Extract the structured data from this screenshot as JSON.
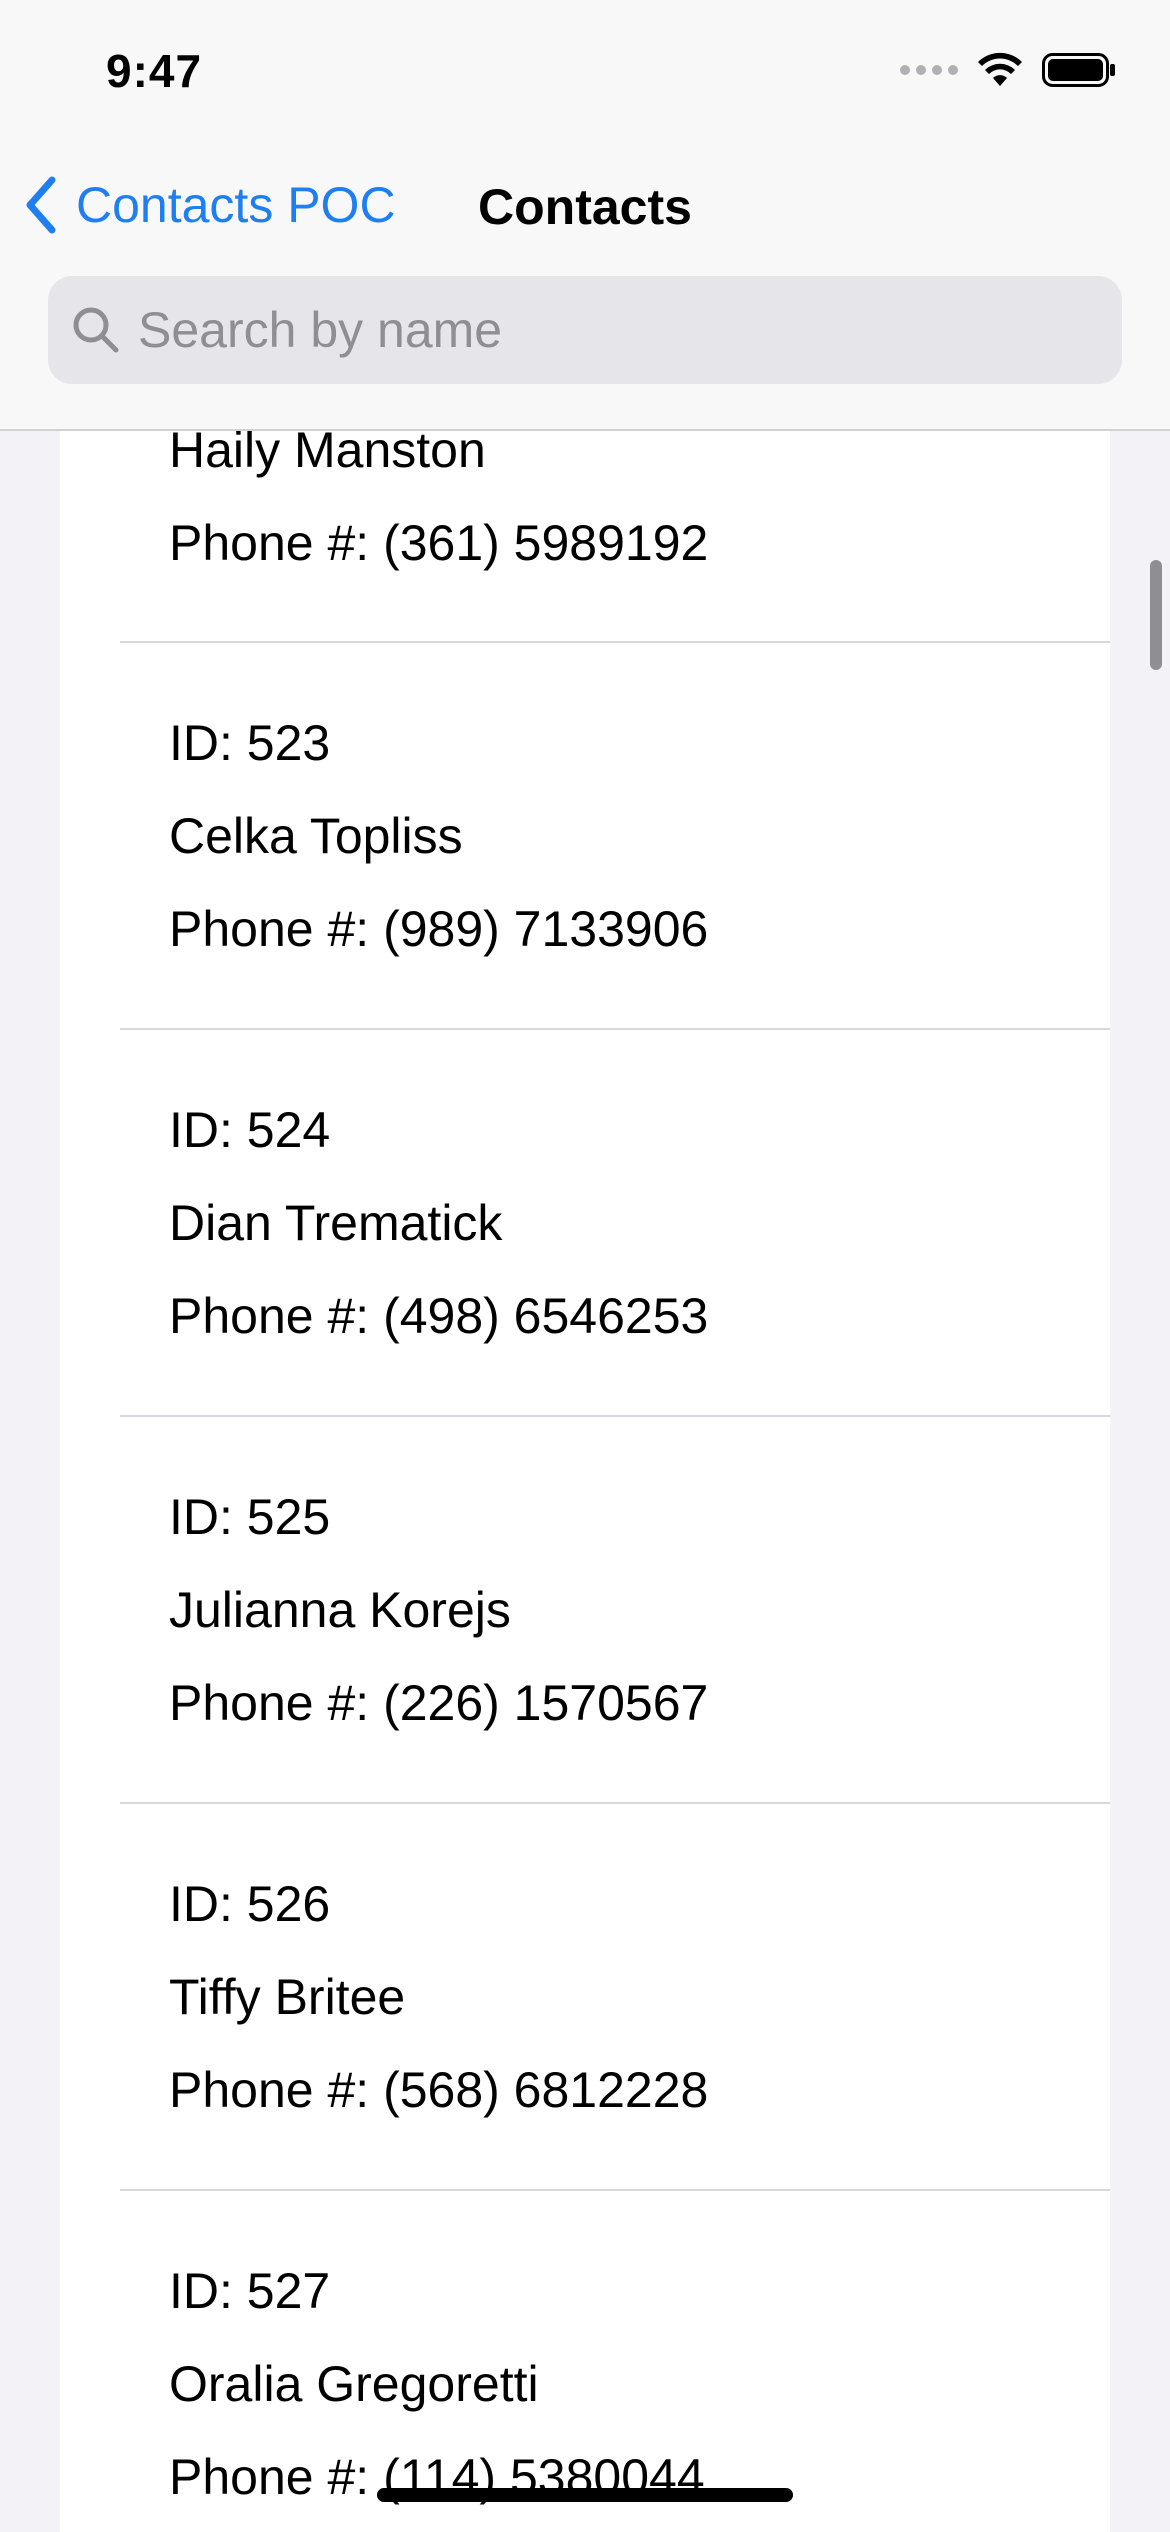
{
  "status_bar": {
    "time": "9:47"
  },
  "nav": {
    "back_label": "Contacts POC",
    "title": "Contacts"
  },
  "search": {
    "placeholder": "Search by name",
    "value": ""
  },
  "contacts": [
    {
      "id": "",
      "name": "Haily Manston",
      "phone": "Phone #: (361) 5989192"
    },
    {
      "id": "ID: 523",
      "name": "Celka Topliss",
      "phone": "Phone #: (989) 7133906"
    },
    {
      "id": "ID: 524",
      "name": "Dian Trematick",
      "phone": "Phone #: (498) 6546253"
    },
    {
      "id": "ID: 525",
      "name": "Julianna Korejs",
      "phone": "Phone #: (226) 1570567"
    },
    {
      "id": "ID: 526",
      "name": "Tiffy Britee",
      "phone": "Phone #: (568) 6812228"
    },
    {
      "id": "ID: 527",
      "name": "Oralia Gregoretti",
      "phone": "Phone #: (114) 5380044"
    }
  ],
  "colors": {
    "accent": "#1f7ff0",
    "background": "#f2f2f7",
    "cell": "#ffffff",
    "separator": "#d8d8dc"
  }
}
